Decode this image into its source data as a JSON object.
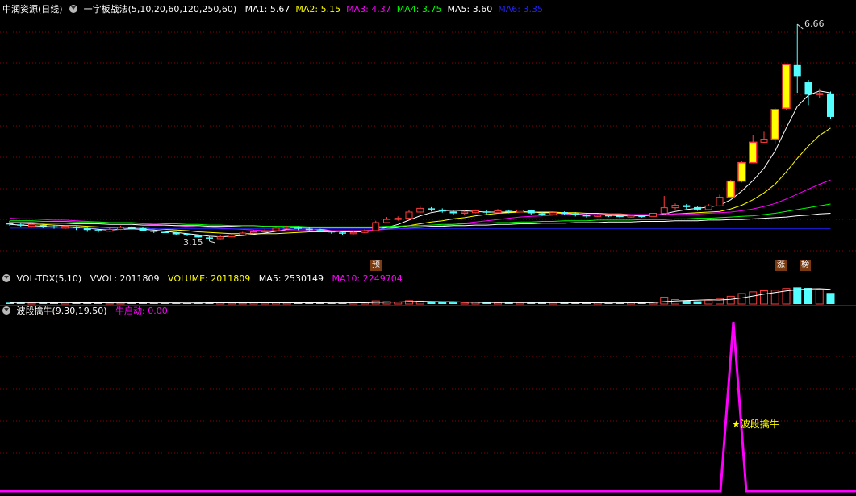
{
  "main": {
    "title": "中润资源(日线)",
    "formula": "一字板战法(5,10,20,60,120,250,60)",
    "ma": [
      {
        "label": "MA1: 5.67",
        "color": "#ffffff"
      },
      {
        "label": "MA2: 5.15",
        "color": "#ffff00"
      },
      {
        "label": "MA3: 4.37",
        "color": "#ff00ff"
      },
      {
        "label": "MA4: 3.75",
        "color": "#00ff00"
      },
      {
        "label": "MA5: 3.60",
        "color": "#ffffff"
      },
      {
        "label": "MA6: 3.35",
        "color": "#2222ff"
      }
    ],
    "high_label": "6.66",
    "low_label": "3.15",
    "tags": {
      "yu": "预",
      "zhang": "涨",
      "bang": "榜"
    }
  },
  "volume": {
    "title": "VOL-TDX(5,10)",
    "vvol": "VVOL: 2011809",
    "volume": "VOLUME: 2011809",
    "ma5": "MA5: 2530149",
    "ma10": "MA10: 2249704"
  },
  "indicator": {
    "title": "波段擒牛(9.30,19.50)",
    "value": "牛启动: 0.00",
    "signal_label": "波段擒牛",
    "signal_value": 1
  },
  "colors": {
    "up": "#ff3c3c",
    "down": "#54ffff",
    "limit_up": "#ffff00",
    "grid": "#8b0000"
  },
  "chart_data": {
    "type": "candlestick",
    "title": "中润资源(日线)",
    "price_range": [
      3.15,
      6.66
    ],
    "candles": [
      [
        3.44,
        3.42,
        3.48,
        3.4
      ],
      [
        3.42,
        3.4,
        3.45,
        3.38
      ],
      [
        3.4,
        3.41,
        3.43,
        3.37
      ],
      [
        3.41,
        3.39,
        3.42,
        3.36
      ],
      [
        3.39,
        3.37,
        3.41,
        3.35
      ],
      [
        3.37,
        3.38,
        3.4,
        3.34
      ],
      [
        3.38,
        3.36,
        3.39,
        3.33
      ],
      [
        3.36,
        3.33,
        3.37,
        3.3
      ],
      [
        3.33,
        3.31,
        3.35,
        3.29
      ],
      [
        3.31,
        3.34,
        3.36,
        3.3
      ],
      [
        3.34,
        3.37,
        3.4,
        3.33
      ],
      [
        3.37,
        3.36,
        3.39,
        3.34
      ],
      [
        3.36,
        3.32,
        3.37,
        3.31
      ],
      [
        3.32,
        3.3,
        3.33,
        3.28
      ],
      [
        3.3,
        3.28,
        3.31,
        3.26
      ],
      [
        3.28,
        3.27,
        3.3,
        3.25
      ],
      [
        3.27,
        3.25,
        3.28,
        3.23
      ],
      [
        3.25,
        3.21,
        3.26,
        3.2
      ],
      [
        3.21,
        3.19,
        3.23,
        3.15
      ],
      [
        3.19,
        3.22,
        3.25,
        3.18
      ],
      [
        3.22,
        3.25,
        3.27,
        3.21
      ],
      [
        3.25,
        3.28,
        3.3,
        3.24
      ],
      [
        3.28,
        3.3,
        3.33,
        3.27
      ],
      [
        3.3,
        3.32,
        3.35,
        3.29
      ],
      [
        3.32,
        3.36,
        3.38,
        3.31
      ],
      [
        3.36,
        3.38,
        3.4,
        3.34
      ],
      [
        3.38,
        3.35,
        3.39,
        3.33
      ],
      [
        3.35,
        3.33,
        3.37,
        3.32
      ],
      [
        3.33,
        3.31,
        3.35,
        3.3
      ],
      [
        3.31,
        3.29,
        3.32,
        3.27
      ],
      [
        3.29,
        3.27,
        3.3,
        3.25
      ],
      [
        3.27,
        3.29,
        3.31,
        3.26
      ],
      [
        3.29,
        3.32,
        3.34,
        3.28
      ],
      [
        3.32,
        3.45,
        3.48,
        3.31
      ],
      [
        3.45,
        3.5,
        3.54,
        3.44
      ],
      [
        3.5,
        3.52,
        3.55,
        3.48
      ],
      [
        3.52,
        3.62,
        3.65,
        3.51
      ],
      [
        3.62,
        3.68,
        3.71,
        3.6
      ],
      [
        3.68,
        3.66,
        3.7,
        3.63
      ],
      [
        3.66,
        3.63,
        3.68,
        3.61
      ],
      [
        3.63,
        3.6,
        3.65,
        3.58
      ],
      [
        3.6,
        3.62,
        3.64,
        3.58
      ],
      [
        3.62,
        3.63,
        3.66,
        3.6
      ],
      [
        3.63,
        3.61,
        3.65,
        3.59
      ],
      [
        3.61,
        3.64,
        3.67,
        3.6
      ],
      [
        3.64,
        3.62,
        3.66,
        3.6
      ],
      [
        3.62,
        3.65,
        3.68,
        3.61
      ],
      [
        3.65,
        3.6,
        3.66,
        3.58
      ],
      [
        3.6,
        3.58,
        3.62,
        3.56
      ],
      [
        3.58,
        3.61,
        3.63,
        3.57
      ],
      [
        3.61,
        3.6,
        3.63,
        3.58
      ],
      [
        3.6,
        3.57,
        3.62,
        3.55
      ],
      [
        3.57,
        3.55,
        3.59,
        3.53
      ],
      [
        3.55,
        3.57,
        3.59,
        3.54
      ],
      [
        3.57,
        3.56,
        3.58,
        3.54
      ],
      [
        3.56,
        3.54,
        3.58,
        3.52
      ],
      [
        3.54,
        3.56,
        3.58,
        3.53
      ],
      [
        3.56,
        3.55,
        3.57,
        3.53
      ],
      [
        3.55,
        3.6,
        3.63,
        3.54
      ],
      [
        3.6,
        3.69,
        3.88,
        3.59
      ],
      [
        3.69,
        3.73,
        3.76,
        3.66
      ],
      [
        3.73,
        3.7,
        3.75,
        3.67
      ],
      [
        3.7,
        3.66,
        3.71,
        3.64
      ],
      [
        3.66,
        3.72,
        3.75,
        3.65
      ],
      [
        3.72,
        3.86,
        3.9,
        3.71
      ],
      [
        3.86,
        4.12,
        4.14,
        3.85
      ],
      [
        4.12,
        4.42,
        4.44,
        4.1
      ],
      [
        4.42,
        4.75,
        4.86,
        4.41
      ],
      [
        4.75,
        4.8,
        4.92,
        4.74
      ],
      [
        4.8,
        5.28,
        5.3,
        4.72
      ],
      [
        5.3,
        6.01,
        6.02,
        5.28
      ],
      [
        6.01,
        5.82,
        6.66,
        5.55
      ],
      [
        5.72,
        5.52,
        5.76,
        5.35
      ],
      [
        5.52,
        5.54,
        5.62,
        5.46
      ],
      [
        5.54,
        5.16,
        5.57,
        5.12
      ]
    ],
    "limit_up_days": [
      65,
      66,
      67,
      69,
      70
    ],
    "ma_lines": [
      {
        "name": "MA1",
        "color": "#ffffff",
        "values": [
          3.42,
          3.41,
          3.4,
          3.39,
          3.38,
          3.38,
          3.37,
          3.36,
          3.34,
          3.33,
          3.34,
          3.35,
          3.34,
          3.33,
          3.31,
          3.29,
          3.27,
          3.25,
          3.23,
          3.22,
          3.23,
          3.24,
          3.26,
          3.28,
          3.31,
          3.34,
          3.35,
          3.35,
          3.34,
          3.32,
          3.3,
          3.3,
          3.3,
          3.33,
          3.37,
          3.42,
          3.49,
          3.56,
          3.61,
          3.64,
          3.65,
          3.64,
          3.63,
          3.62,
          3.62,
          3.62,
          3.63,
          3.62,
          3.61,
          3.61,
          3.6,
          3.59,
          3.58,
          3.58,
          3.57,
          3.56,
          3.56,
          3.56,
          3.57,
          3.59,
          3.63,
          3.66,
          3.68,
          3.7,
          3.73,
          3.82,
          3.96,
          4.13,
          4.33,
          4.61,
          4.98,
          5.33,
          5.51,
          5.58,
          5.55
        ]
      },
      {
        "name": "MA2",
        "color": "#ffff00",
        "values": [
          3.45,
          3.44,
          3.43,
          3.42,
          3.41,
          3.4,
          3.4,
          3.39,
          3.38,
          3.37,
          3.36,
          3.36,
          3.36,
          3.35,
          3.34,
          3.33,
          3.32,
          3.3,
          3.29,
          3.28,
          3.27,
          3.27,
          3.27,
          3.27,
          3.27,
          3.28,
          3.29,
          3.3,
          3.3,
          3.3,
          3.31,
          3.31,
          3.32,
          3.33,
          3.35,
          3.37,
          3.4,
          3.43,
          3.46,
          3.48,
          3.51,
          3.53,
          3.56,
          3.58,
          3.6,
          3.61,
          3.62,
          3.62,
          3.62,
          3.62,
          3.61,
          3.61,
          3.6,
          3.6,
          3.59,
          3.59,
          3.58,
          3.58,
          3.58,
          3.58,
          3.59,
          3.6,
          3.61,
          3.62,
          3.63,
          3.67,
          3.73,
          3.82,
          3.93,
          4.07,
          4.27,
          4.49,
          4.69,
          4.86,
          4.98
        ]
      },
      {
        "name": "MA3",
        "color": "#ff00ff",
        "values": [
          3.52,
          3.51,
          3.51,
          3.5,
          3.49,
          3.49,
          3.48,
          3.47,
          3.46,
          3.45,
          3.45,
          3.44,
          3.43,
          3.42,
          3.41,
          3.4,
          3.39,
          3.38,
          3.37,
          3.36,
          3.35,
          3.34,
          3.33,
          3.32,
          3.32,
          3.32,
          3.32,
          3.32,
          3.32,
          3.32,
          3.32,
          3.32,
          3.32,
          3.33,
          3.34,
          3.35,
          3.36,
          3.37,
          3.39,
          3.4,
          3.42,
          3.44,
          3.46,
          3.48,
          3.5,
          3.52,
          3.54,
          3.55,
          3.56,
          3.57,
          3.58,
          3.58,
          3.58,
          3.58,
          3.58,
          3.58,
          3.58,
          3.58,
          3.58,
          3.58,
          3.59,
          3.59,
          3.59,
          3.6,
          3.61,
          3.62,
          3.64,
          3.67,
          3.71,
          3.76,
          3.83,
          3.91,
          3.99,
          4.07,
          4.14
        ]
      },
      {
        "name": "MA4",
        "color": "#00ff00",
        "values": [
          3.48,
          3.48,
          3.48,
          3.47,
          3.47,
          3.47,
          3.46,
          3.46,
          3.46,
          3.45,
          3.45,
          3.45,
          3.44,
          3.44,
          3.43,
          3.43,
          3.42,
          3.42,
          3.41,
          3.41,
          3.4,
          3.4,
          3.4,
          3.39,
          3.39,
          3.39,
          3.39,
          3.38,
          3.38,
          3.38,
          3.38,
          3.38,
          3.38,
          3.38,
          3.39,
          3.39,
          3.4,
          3.4,
          3.41,
          3.42,
          3.42,
          3.43,
          3.44,
          3.44,
          3.45,
          3.45,
          3.46,
          3.46,
          3.47,
          3.47,
          3.48,
          3.48,
          3.48,
          3.49,
          3.49,
          3.49,
          3.49,
          3.5,
          3.5,
          3.5,
          3.51,
          3.51,
          3.52,
          3.52,
          3.53,
          3.54,
          3.55,
          3.56,
          3.58,
          3.6,
          3.63,
          3.66,
          3.69,
          3.72,
          3.75
        ]
      },
      {
        "name": "MA5",
        "color": "#ffffff",
        "values": [
          3.45,
          3.45,
          3.45,
          3.44,
          3.44,
          3.44,
          3.43,
          3.43,
          3.43,
          3.42,
          3.42,
          3.42,
          3.41,
          3.41,
          3.41,
          3.4,
          3.4,
          3.4,
          3.39,
          3.39,
          3.39,
          3.38,
          3.38,
          3.38,
          3.38,
          3.37,
          3.37,
          3.37,
          3.37,
          3.37,
          3.37,
          3.37,
          3.37,
          3.37,
          3.37,
          3.38,
          3.38,
          3.38,
          3.39,
          3.39,
          3.4,
          3.4,
          3.41,
          3.41,
          3.42,
          3.42,
          3.43,
          3.43,
          3.44,
          3.44,
          3.44,
          3.45,
          3.45,
          3.45,
          3.46,
          3.46,
          3.46,
          3.47,
          3.47,
          3.47,
          3.48,
          3.48,
          3.48,
          3.49,
          3.49,
          3.5,
          3.5,
          3.51,
          3.52,
          3.53,
          3.54,
          3.56,
          3.57,
          3.59,
          3.6
        ]
      },
      {
        "name": "MA6",
        "color": "#2222ff",
        "values": [
          3.36,
          3.36,
          3.36,
          3.36,
          3.36,
          3.36,
          3.36,
          3.36,
          3.36,
          3.36,
          3.36,
          3.36,
          3.36,
          3.35,
          3.35,
          3.35,
          3.35,
          3.35,
          3.35,
          3.35,
          3.35,
          3.35,
          3.35,
          3.35,
          3.35,
          3.35,
          3.35,
          3.35,
          3.35,
          3.35,
          3.35,
          3.35,
          3.35,
          3.35,
          3.35,
          3.35,
          3.35,
          3.35,
          3.35,
          3.35,
          3.35,
          3.35,
          3.35,
          3.35,
          3.35,
          3.35,
          3.35,
          3.35,
          3.35,
          3.35,
          3.35,
          3.35,
          3.35,
          3.35,
          3.35,
          3.35,
          3.35,
          3.35,
          3.35,
          3.35,
          3.35,
          3.35,
          3.35,
          3.35,
          3.35,
          3.35,
          3.35,
          3.35,
          3.35,
          3.35,
          3.35,
          3.35,
          3.35,
          3.35,
          3.35
        ]
      }
    ],
    "volume_values": [
      12,
      14,
      10,
      11,
      9,
      13,
      10,
      12,
      11,
      9,
      10,
      13,
      11,
      9,
      8,
      10,
      9,
      12,
      14,
      11,
      10,
      9,
      12,
      11,
      13,
      10,
      9,
      11,
      12,
      10,
      9,
      11,
      13,
      28,
      22,
      16,
      30,
      26,
      18,
      15,
      14,
      12,
      15,
      13,
      11,
      14,
      12,
      10,
      11,
      13,
      12,
      10,
      9,
      11,
      10,
      12,
      11,
      10,
      15,
      62,
      40,
      30,
      25,
      35,
      50,
      70,
      95,
      110,
      120,
      125,
      140,
      150,
      145,
      130,
      100
    ],
    "signal_values": [
      0,
      0,
      0,
      0,
      0,
      0,
      0,
      0,
      0,
      0,
      0,
      0,
      0,
      0,
      0,
      0,
      0,
      0,
      0,
      0,
      0,
      0,
      0,
      0,
      0,
      0,
      0,
      0,
      0,
      0,
      0,
      0,
      0,
      0,
      0,
      0,
      0,
      0,
      0,
      0,
      0,
      0,
      0,
      0,
      0,
      0,
      0,
      0,
      0,
      0,
      0,
      0,
      0,
      0,
      0,
      0,
      0,
      0,
      0,
      0,
      0,
      0,
      0,
      0,
      0,
      0,
      1,
      0,
      0,
      0,
      0,
      0,
      0,
      0,
      0
    ]
  }
}
